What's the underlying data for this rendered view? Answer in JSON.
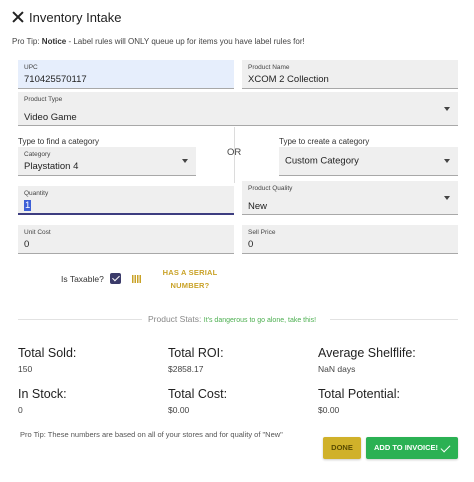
{
  "header": {
    "title": "Inventory Intake"
  },
  "tip_top": {
    "prefix": "Pro Tip: ",
    "bold": "Notice",
    "rest": " - Label rules will ONLY queue up for items you have label rules for!"
  },
  "upc": {
    "label": "UPC",
    "value": "710425570117"
  },
  "product_name": {
    "label": "Product Name",
    "value": "XCOM 2 Collection"
  },
  "product_type": {
    "label": "Product Type",
    "value": "Video Game"
  },
  "find_category": {
    "heading": "Type to find a category",
    "label": "Category",
    "value": "Playstation 4"
  },
  "or_text": "OR",
  "create_category": {
    "heading": "Type to create a category",
    "value": "Custom Category"
  },
  "quantity": {
    "label": "Quantity",
    "value": "1"
  },
  "product_quality": {
    "label": "Product Quality",
    "value": "New"
  },
  "unit_cost": {
    "label": "Unit Cost",
    "value": "0"
  },
  "sell_price": {
    "label": "Sell Price",
    "value": "0"
  },
  "taxable": {
    "label": "Is Taxable?",
    "checked": true
  },
  "serial_button": {
    "line1": "HAS A SERIAL",
    "line2": "NUMBER?"
  },
  "stats": {
    "title": "Product Stats:",
    "quote": "It's dangerous to go alone, take this!",
    "total_sold": {
      "label": "Total Sold:",
      "value": "150"
    },
    "total_roi": {
      "label": "Total ROI:",
      "value": "$2858.17"
    },
    "avg_shelflife": {
      "label": "Average Shelflife:",
      "value": "NaN days"
    },
    "in_stock": {
      "label": "In Stock:",
      "value": "0"
    },
    "total_cost": {
      "label": "Total Cost:",
      "value": "$0.00"
    },
    "total_potential": {
      "label": "Total Potential:",
      "value": "$0.00"
    }
  },
  "tip_bottom": "Pro Tip: These numbers are based on all of your stores and for quality of \"New\"",
  "buttons": {
    "done": "DONE",
    "add_to_invoice": "ADD TO INVOICE!"
  },
  "colors": {
    "accent_dark": "#3b3b6a",
    "gold": "#c9a227",
    "green": "#2bb153",
    "done_bg": "#d0b12a"
  }
}
